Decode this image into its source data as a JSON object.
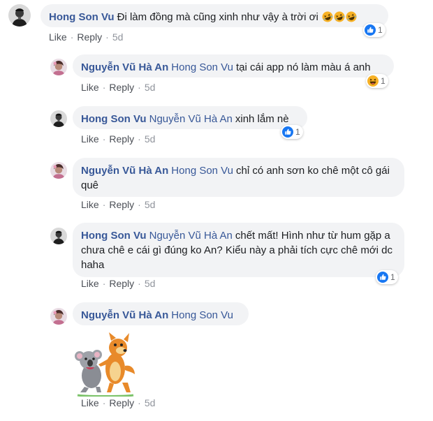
{
  "colors": {
    "author": "#385898",
    "bubble": "#f2f3f5",
    "meta": "#90949c",
    "like_blue": "#1877f2",
    "haha_yellow": "#f7b125"
  },
  "actions": {
    "like": "Like",
    "reply": "Reply",
    "separator": "·"
  },
  "comments": [
    {
      "author": "Hong Son Vu",
      "tag": "",
      "text": "Đi làm đồng mà cũng xinh như vậy à trời ơi",
      "emojis": [
        "rofl-emoji",
        "rofl-emoji",
        "rofl-emoji"
      ],
      "time": "5d",
      "reaction_icons": [
        "like-icon"
      ],
      "reaction_count": "1",
      "avatar": "hong-son-vu-avatar"
    },
    {
      "author": "Nguyễn Vũ Hà An",
      "tag": "Hong Son Vu",
      "text": "tại cái app nó làm màu á anh",
      "time": "5d",
      "reaction_icons": [
        "haha-icon"
      ],
      "reaction_count": "1",
      "avatar": "nguyen-vu-ha-an-avatar"
    },
    {
      "author": "Hong Son Vu",
      "tag": "Nguyễn Vũ Hà An",
      "text": "xinh lắm nè",
      "time": "5d",
      "reaction_icons": [
        "like-icon"
      ],
      "reaction_count": "1",
      "avatar": "hong-son-vu-avatar"
    },
    {
      "author": "Nguyễn Vũ Hà An",
      "tag": "Hong Son Vu",
      "text": "chỉ có anh sơn ko chê một cô gái quê",
      "time": "5d",
      "reaction_icons": [],
      "reaction_count": "",
      "avatar": "nguyen-vu-ha-an-avatar"
    },
    {
      "author": "Hong Son Vu",
      "tag": "Nguyễn Vũ Hà An",
      "text": "chết mất! Hình như từ hum gặp a chưa chê e cái gì đúng ko An? Kiểu này a phải tích cực chê mới dc haha",
      "time": "5d",
      "reaction_icons": [
        "like-icon"
      ],
      "reaction_count": "1",
      "avatar": "hong-son-vu-avatar"
    },
    {
      "author": "Nguyễn Vũ Hà An",
      "tag": "Hong Son Vu",
      "text": "",
      "sticker": "koala-and-fox-sticker",
      "time": "5d",
      "reaction_icons": [],
      "reaction_count": "",
      "avatar": "nguyen-vu-ha-an-avatar"
    }
  ]
}
